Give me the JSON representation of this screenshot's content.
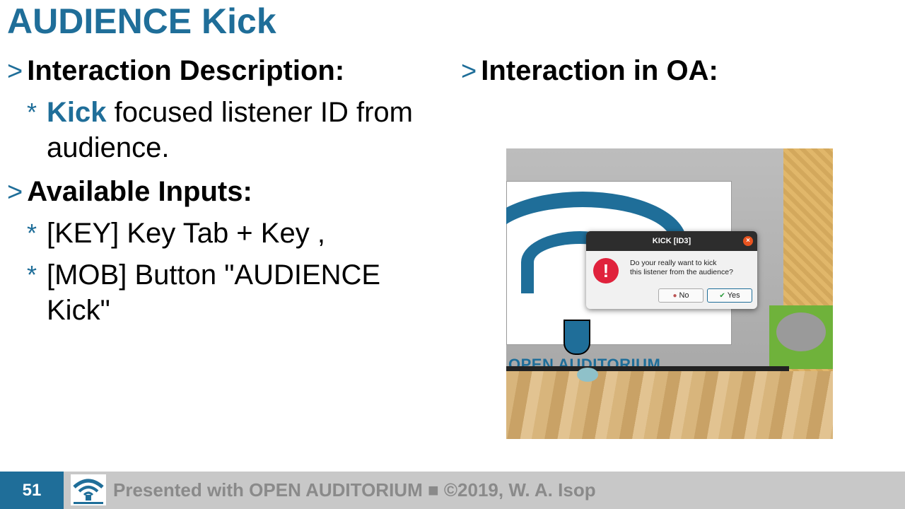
{
  "slide": {
    "title": "AUDIENCE Kick",
    "left": {
      "heading1": "Interaction Description:",
      "bullet1_accent": "Kick",
      "bullet1_rest": " focused listener ID from",
      "bullet1_line2": "audience.",
      "heading2": "Available Inputs:",
      "input1": "[KEY] Key Tab + Key ,",
      "input2_line1": "[MOB] Button \"AUDIENCE",
      "input2_line2": "Kick\""
    },
    "right": {
      "heading": "Interaction in OA:"
    },
    "marker_heading": ">",
    "marker_bullet": "*"
  },
  "screenshot": {
    "dialog_title": "KICK [ID3]",
    "dialog_text_line1": "Do your really want to kick",
    "dialog_text_line2": "this listener from the audience?",
    "no_label": "No",
    "yes_label": "Yes",
    "poster_text": "OPEN AUDITORIUM",
    "close_glyph": "×",
    "warning_glyph": "!"
  },
  "footer": {
    "page_number": "51",
    "text": "Presented with OPEN AUDITORIUM ■ ©2019, W. A. Isop"
  },
  "colors": {
    "accent": "#1f6e99",
    "footer_bg": "#c8c8c8",
    "footer_text": "#8a8a8a"
  }
}
